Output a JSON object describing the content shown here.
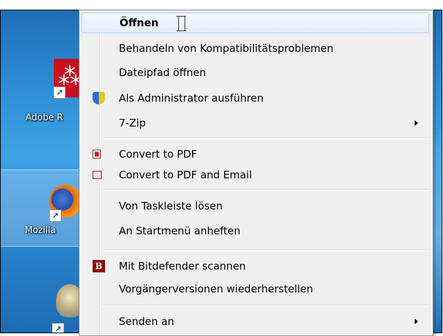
{
  "top_caption": "",
  "desktop": {
    "icons": [
      {
        "label": "Adobe R"
      },
      {
        "label": "Mozilla"
      }
    ]
  },
  "menu": {
    "items": [
      {
        "label": "Öffnen",
        "default": true
      },
      {
        "label": "Behandeln von Kompatibilitätsproblemen"
      },
      {
        "label": "Dateipfad öffnen"
      },
      {
        "label": "Als Administrator ausführen",
        "icon": "shield-icon"
      },
      {
        "label": "7-Zip",
        "submenu": true
      },
      {
        "label": "Convert to PDF",
        "icon": "pdf-icon"
      },
      {
        "label": "Convert to PDF and Email",
        "icon": "pdf-mail-icon"
      },
      {
        "label": "Von Taskleiste lösen"
      },
      {
        "label": "An Startmenü anheften"
      },
      {
        "label": "Mit Bitdefender scannen",
        "icon": "bitdefender-icon"
      },
      {
        "label": "Vorgängerversionen wiederherstellen"
      },
      {
        "label": "Senden an",
        "submenu": true
      }
    ]
  },
  "colors": {
    "menu_background": "#f0f0f0",
    "hover_border": "#aecff7",
    "desktop_blue": "#2f8ed6"
  }
}
